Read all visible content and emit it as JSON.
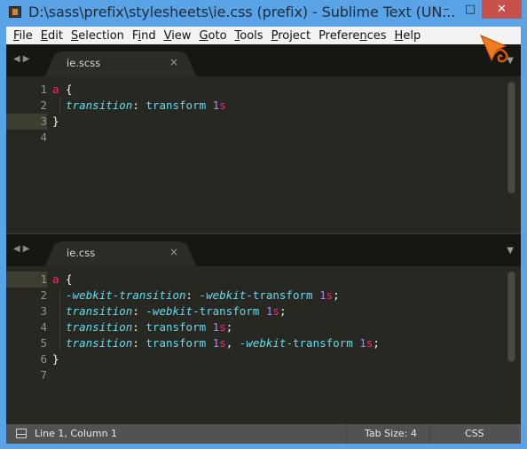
{
  "window": {
    "title": "D:\\sass\\prefix\\stylesheets\\ie.css (prefix) - Sublime Text (UN...",
    "minimize_label": "–",
    "maximize_label": "□",
    "close_label": "✕"
  },
  "menubar": {
    "items": [
      {
        "label": "File",
        "mnemonic": "F"
      },
      {
        "label": "Edit",
        "mnemonic": "E"
      },
      {
        "label": "Selection",
        "mnemonic": "S"
      },
      {
        "label": "Find",
        "mnemonic": "i"
      },
      {
        "label": "View",
        "mnemonic": "V"
      },
      {
        "label": "Goto",
        "mnemonic": "G"
      },
      {
        "label": "Tools",
        "mnemonic": "T"
      },
      {
        "label": "Project",
        "mnemonic": "P"
      },
      {
        "label": "Preferences",
        "mnemonic": "n"
      },
      {
        "label": "Help",
        "mnemonic": "H"
      }
    ]
  },
  "panes": [
    {
      "tab_label": "ie.scss",
      "tab_close": "×",
      "nav_arrows": "◀▶",
      "menu_arrow": "▼",
      "active_line": 3,
      "lines": [
        {
          "num": "1",
          "tokens": [
            {
              "t": "tag",
              "v": "a"
            },
            {
              "t": "punc",
              "v": " {"
            }
          ]
        },
        {
          "num": "2",
          "tokens": [
            {
              "t": "punc",
              "v": "  "
            },
            {
              "t": "prop",
              "v": "transition"
            },
            {
              "t": "punc",
              "v": ": "
            },
            {
              "t": "val",
              "v": "transform "
            },
            {
              "t": "num",
              "v": "1"
            },
            {
              "t": "unit",
              "v": "s"
            }
          ]
        },
        {
          "num": "3",
          "tokens": [
            {
              "t": "punc",
              "v": "}"
            }
          ]
        },
        {
          "num": "4",
          "tokens": []
        }
      ]
    },
    {
      "tab_label": "ie.css",
      "tab_close": "×",
      "nav_arrows": "◀▶",
      "menu_arrow": "▼",
      "active_line": 1,
      "lines": [
        {
          "num": "1",
          "tokens": [
            {
              "t": "tag",
              "v": "a"
            },
            {
              "t": "punc",
              "v": " {"
            }
          ]
        },
        {
          "num": "2",
          "tokens": [
            {
              "t": "punc",
              "v": "  "
            },
            {
              "t": "prop",
              "v": "-webkit-transition"
            },
            {
              "t": "punc",
              "v": ": "
            },
            {
              "t": "prop",
              "v": "-webkit"
            },
            {
              "t": "val",
              "v": "-transform "
            },
            {
              "t": "num",
              "v": "1"
            },
            {
              "t": "unit",
              "v": "s"
            },
            {
              "t": "punc",
              "v": ";"
            }
          ]
        },
        {
          "num": "3",
          "tokens": [
            {
              "t": "punc",
              "v": "  "
            },
            {
              "t": "prop",
              "v": "transition"
            },
            {
              "t": "punc",
              "v": ": "
            },
            {
              "t": "prop",
              "v": "-webkit"
            },
            {
              "t": "val",
              "v": "-transform "
            },
            {
              "t": "num",
              "v": "1"
            },
            {
              "t": "unit",
              "v": "s"
            },
            {
              "t": "punc",
              "v": ";"
            }
          ]
        },
        {
          "num": "4",
          "tokens": [
            {
              "t": "punc",
              "v": "  "
            },
            {
              "t": "prop",
              "v": "transition"
            },
            {
              "t": "punc",
              "v": ": "
            },
            {
              "t": "val",
              "v": "transform "
            },
            {
              "t": "num",
              "v": "1"
            },
            {
              "t": "unit",
              "v": "s"
            },
            {
              "t": "punc",
              "v": ";"
            }
          ]
        },
        {
          "num": "5",
          "tokens": [
            {
              "t": "punc",
              "v": "  "
            },
            {
              "t": "prop",
              "v": "transition"
            },
            {
              "t": "punc",
              "v": ": "
            },
            {
              "t": "val",
              "v": "transform "
            },
            {
              "t": "num",
              "v": "1"
            },
            {
              "t": "unit",
              "v": "s"
            },
            {
              "t": "punc",
              "v": ", "
            },
            {
              "t": "prop",
              "v": "-webkit"
            },
            {
              "t": "val",
              "v": "-transform "
            },
            {
              "t": "num",
              "v": "1"
            },
            {
              "t": "unit",
              "v": "s"
            },
            {
              "t": "punc",
              "v": ";"
            }
          ]
        },
        {
          "num": "6",
          "tokens": [
            {
              "t": "punc",
              "v": "}"
            }
          ]
        },
        {
          "num": "7",
          "tokens": []
        }
      ]
    }
  ],
  "statusbar": {
    "position": "Line 1, Column 1",
    "tab_size": "Tab Size: 4",
    "syntax": "CSS"
  },
  "colors": {
    "window_frame": "#5aa3e6",
    "close_button": "#c7504a",
    "editor_bg": "#272822",
    "keyword": "#f92672",
    "property": "#66d9ef",
    "number": "#ae81ff"
  }
}
